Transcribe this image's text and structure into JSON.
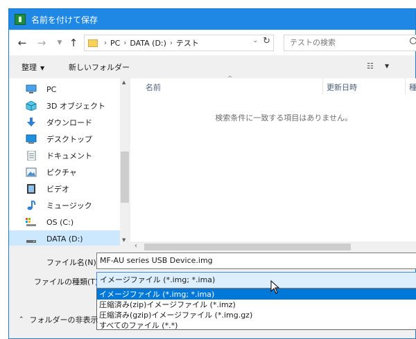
{
  "window": {
    "title": "名前を付けて保存"
  },
  "nav": {
    "back_icon": "arrow-left-icon",
    "forward_icon": "arrow-right-icon",
    "recent_icon": "chevron-down-icon",
    "up_icon": "arrow-up-icon"
  },
  "address": {
    "crumbs": [
      "PC",
      "DATA (D:)",
      "テスト"
    ],
    "search_placeholder": "テストの検索"
  },
  "toolbar": {
    "organize": "整理",
    "new_folder": "新しいフォルダー"
  },
  "sidebar": {
    "items": [
      {
        "label": "PC",
        "icon": "computer-icon"
      },
      {
        "label": "3D オブジェクト",
        "icon": "cube-3d-icon"
      },
      {
        "label": "ダウンロード",
        "icon": "download-icon"
      },
      {
        "label": "デスクトップ",
        "icon": "desktop-icon"
      },
      {
        "label": "ドキュメント",
        "icon": "document-icon"
      },
      {
        "label": "ピクチャ",
        "icon": "picture-icon"
      },
      {
        "label": "ビデオ",
        "icon": "video-icon"
      },
      {
        "label": "ミュージック",
        "icon": "music-icon"
      },
      {
        "label": "OS (C:)",
        "icon": "drive-c-icon"
      },
      {
        "label": "DATA (D:)",
        "icon": "drive-d-icon"
      }
    ]
  },
  "content": {
    "columns": [
      "名前",
      "更新日時",
      "種"
    ],
    "empty_message": "検索条件に一致する項目はありません。"
  },
  "form": {
    "filename_label": "ファイル名(N):",
    "filename_value": "MF-AU series USB Device.img",
    "filetype_label": "ファイルの種類(T):",
    "filetype_value": "イメージファイル (*.img; *.ima)",
    "filetype_options": [
      "イメージファイル (*.img; *.ima)",
      "圧縮済み(zip)イメージファイル (*.imz)",
      "圧縮済み(gzip)イメージファイル (*.img.gz)",
      "すべてのファイル (*.*)"
    ],
    "selected_option_index": 0,
    "hide_folders": "フォルダーの非表示"
  },
  "colors": {
    "titlebar": "#1f88e5",
    "selection": "#0078d7",
    "nav_selected": "#cce8ff"
  }
}
